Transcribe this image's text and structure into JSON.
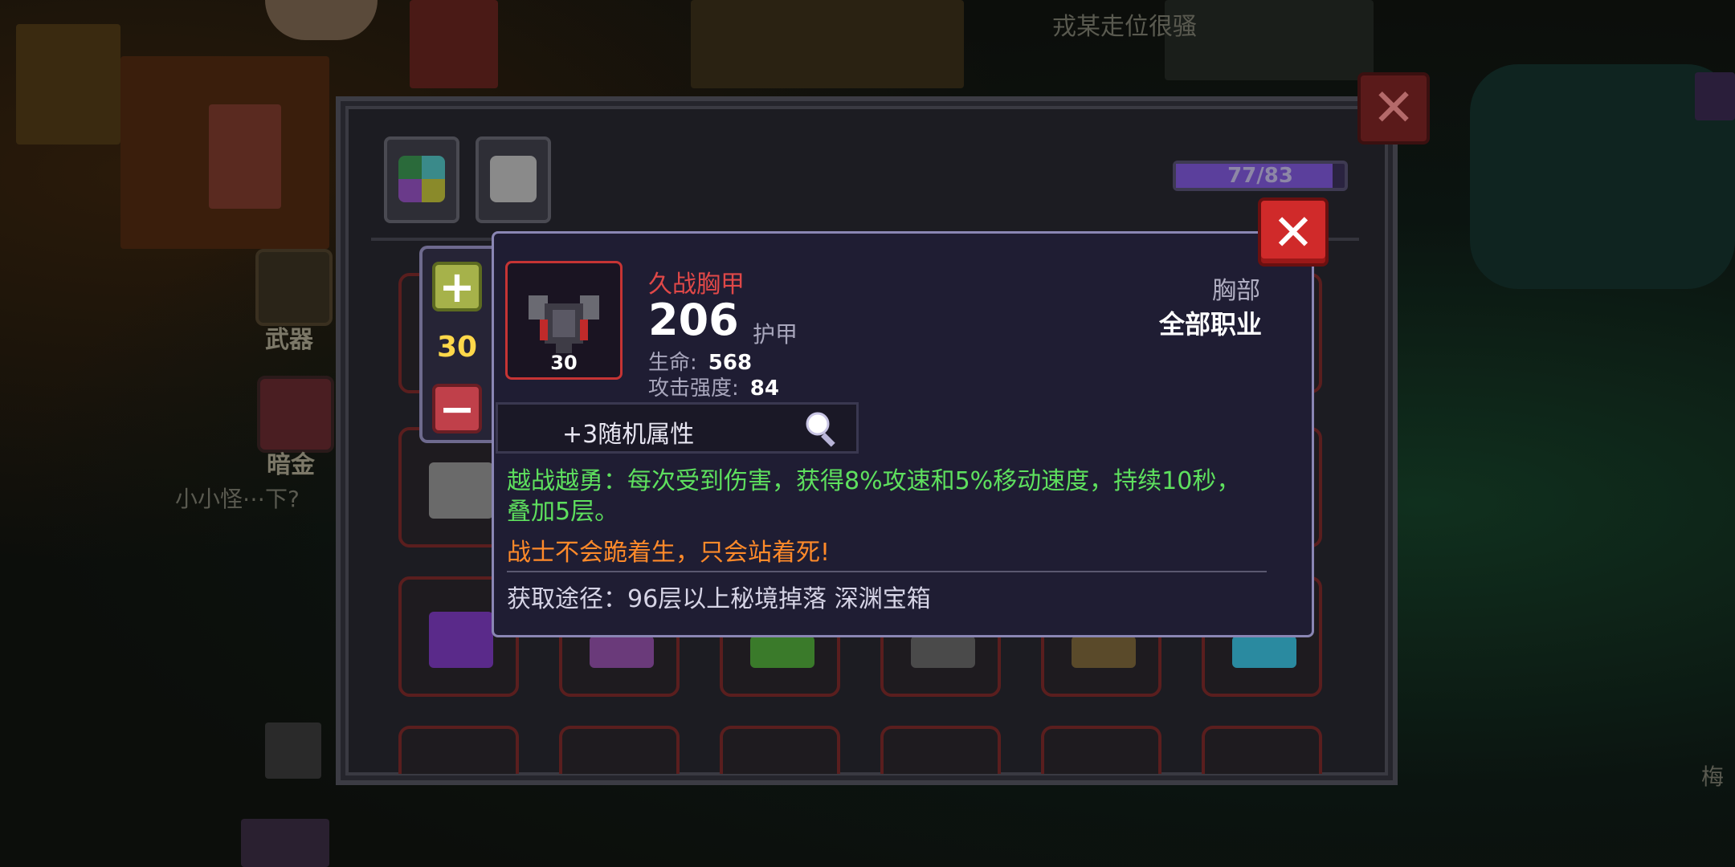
{
  "background": {
    "player_name_top": "戎某走位很骚",
    "side_label_weapon": "武器",
    "side_label_darkgold": "暗金",
    "side_label_player": "小小怪⋯下?",
    "side_label_right": "梅"
  },
  "inventory": {
    "capacity_text": "77/83",
    "capacity_fraction": 0.928
  },
  "stepper": {
    "plus_label": "+",
    "value": "30",
    "minus_label": "−"
  },
  "tooltip": {
    "item_name": "久战胸甲",
    "item_level": "30",
    "armor_value": "206",
    "armor_label": "护甲",
    "stats": [
      {
        "label": "生命:",
        "value": "568"
      },
      {
        "label": "攻击强度:",
        "value": "84"
      }
    ],
    "slot_type": "胸部",
    "class_type": "全部职业",
    "random_attr": "+3随机属性",
    "effect_text": "越战越勇：每次受到伤害，获得8%攻速和5%移动速度，持续10秒，叠加5层。",
    "flavor_text": "战士不会跪着生，只会站着死!",
    "source_text": "获取途径：96层以上秘境掉落 深渊宝箱",
    "close_label": "✕"
  },
  "outer_close_label": "✕",
  "colors": {
    "item_name": "#e04848",
    "effect_green": "#5ee05e",
    "flavor_orange": "#ff8a2a",
    "stepper_value": "#ffd84a",
    "close_red": "#d02a2a"
  }
}
